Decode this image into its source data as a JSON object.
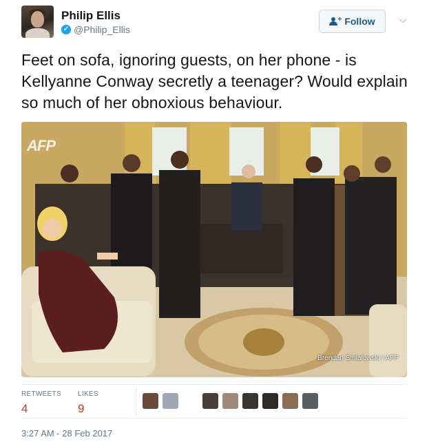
{
  "author": {
    "name": "Philip Ellis",
    "handle": "@Philip_Ellis",
    "verified": true
  },
  "follow_label": "Follow",
  "tweet_text": "Feet on sofa, ignoring guests, on her phone - is Kellyanne Conway secretly a teenager? Would explain so much of her obnoxious behaviour.",
  "photo": {
    "watermark": "AFP",
    "credit": "Brendan Smialowski / AFP"
  },
  "stats": {
    "retweets_label": "RETWEETS",
    "retweets_value": "4",
    "likes_label": "LIKES",
    "likes_value": "9"
  },
  "liker_avatars": [
    {
      "color": "#6b4a3a"
    },
    {
      "color": "#9fa9b3"
    },
    {
      "color": "#ffffff"
    },
    {
      "color": "#4a3f38"
    },
    {
      "color": "#a08a7a"
    },
    {
      "color": "#3a3531"
    },
    {
      "color": "#2f2a28"
    },
    {
      "color": "#8c6b55"
    },
    {
      "color": "#5a5e63"
    }
  ],
  "timestamp": "3:27 AM - 28 Feb 2017",
  "colors": {
    "accent": "#1da1f2",
    "count_red": "#c0392b",
    "muted": "#657786"
  }
}
